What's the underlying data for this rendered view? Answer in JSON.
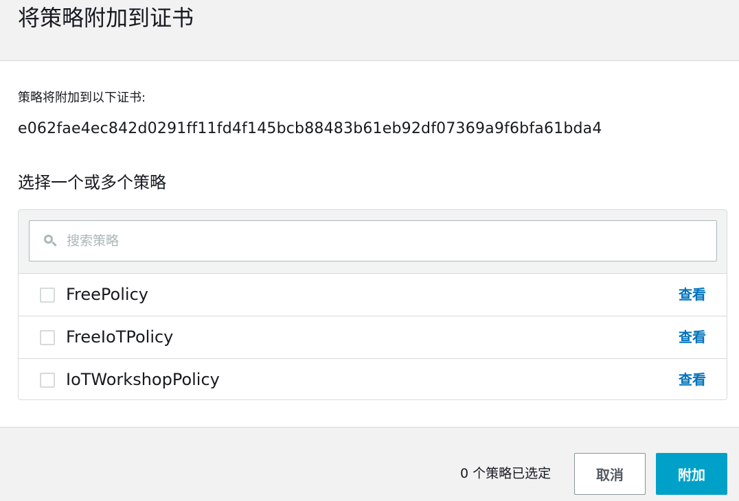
{
  "dialog": {
    "title": "将策略附加到证书"
  },
  "intro": {
    "label": "策略将附加到以下证书:",
    "certificate_id": "e062fae4ec842d0291ff11fd4f145bcb88483b61eb92df07369a9f6bfa61bda4"
  },
  "policy_section": {
    "heading": "选择一个或多个策略",
    "search": {
      "placeholder": "搜索策略",
      "value": "",
      "icon": "search-icon"
    },
    "policies": [
      {
        "name": "FreePolicy",
        "checked": false,
        "view_label": "查看"
      },
      {
        "name": "FreeIoTPolicy",
        "checked": false,
        "view_label": "查看"
      },
      {
        "name": "IoTWorkshopPolicy",
        "checked": false,
        "view_label": "查看"
      }
    ]
  },
  "footer": {
    "selected_count_text": "0 个策略已选定",
    "cancel_label": "取消",
    "attach_label": "附加"
  },
  "colors": {
    "link": "#0073bb",
    "primary_button": "#00a1c9",
    "header_bg": "#f2f2f2"
  }
}
